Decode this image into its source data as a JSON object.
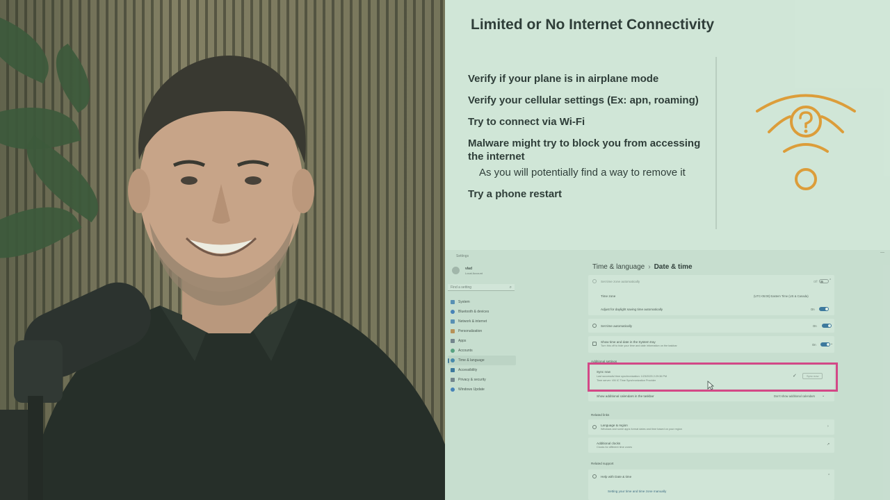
{
  "slide": {
    "title": "Limited or No Internet Connectivity",
    "bullets": [
      "Verify if your plane is in airplane mode",
      "Verify your cellular settings (Ex: apn, roaming)",
      "Try to connect via Wi-Fi",
      "Malware might try to block you from accessing the internet"
    ],
    "sub_bullet": "As you will potentially find a way to remove it",
    "last_bullet": "Try a phone restart",
    "accent_color": "#e0952a"
  },
  "settings": {
    "window_title": "Settings",
    "user": {
      "name": "vlad",
      "account": "Local Account"
    },
    "search_placeholder": "Find a setting",
    "nav": [
      "System",
      "Bluetooth & devices",
      "Network & internet",
      "Personalization",
      "Apps",
      "Accounts",
      "Time & language",
      "Accessibility",
      "Privacy & security",
      "Windows Update"
    ],
    "active_nav_index": 6,
    "breadcrumb": {
      "parent": "Time & language",
      "current": "Date & time"
    },
    "rows": {
      "set_timezone_auto": "Set time zone automatically",
      "set_timezone_auto_state": "Off",
      "time_zone": "Time zone",
      "time_zone_value": "(UTC-05:00) Eastern Time (US & Canada)",
      "dst": "Adjust for daylight saving time automatically",
      "dst_state": "On",
      "set_time_auto": "Set time automatically",
      "set_time_auto_state": "On",
      "tray": "Show time and date in the System tray",
      "tray_sub": "Turn this off to hide your time and date information on the taskbar",
      "tray_state": "On",
      "additional_settings": "Additional settings",
      "sync_now": "Sync now",
      "sync_last": "Last successful time synchronization: 1/23/2025 2:29:36 PM",
      "sync_server": "Time server: VM IC Time Synchronization Provider",
      "sync_button": "Sync now",
      "calendars": "Show additional calendars in the taskbar",
      "calendars_value": "Don't show additional calendars",
      "related_links": "Related links",
      "language_region": "Language & region",
      "language_region_sub": "Windows and some apps format dates and time based on your region",
      "additional_clocks": "Additional clocks",
      "additional_clocks_sub": "Clocks for different time zones",
      "related_support": "Related support",
      "help": "Help with Date & time",
      "help_link": "Setting your time and time zone manually"
    },
    "highlight_color": "#d6367f"
  }
}
